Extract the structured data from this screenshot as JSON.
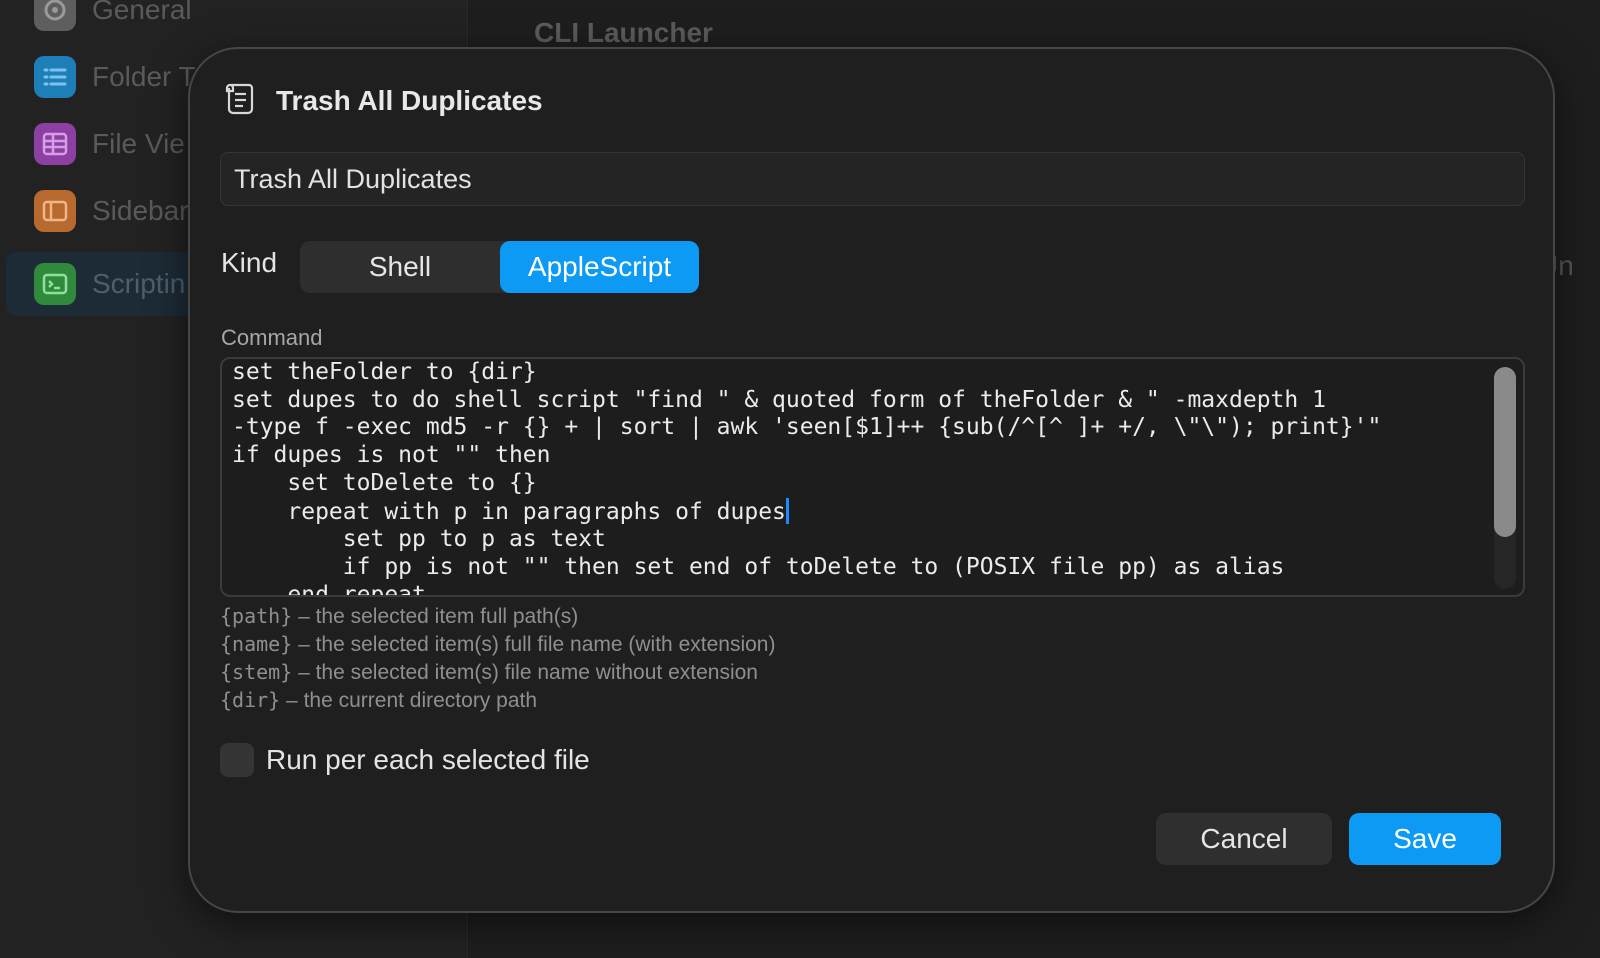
{
  "background": {
    "sidebar": {
      "items": [
        {
          "label": "General",
          "icon": "gear-icon",
          "color": "#5e5e5e"
        },
        {
          "label": "Folder T",
          "icon": "list-icon",
          "color": "#1e7fb8"
        },
        {
          "label": "File Vie",
          "icon": "table-icon",
          "color": "#8e3fa3"
        },
        {
          "label": "Sidebar",
          "icon": "sidebar-icon",
          "color": "#b8692e"
        },
        {
          "label": "Scriptin",
          "icon": "terminal-icon",
          "color": "#2f8a3c"
        }
      ],
      "selected_index": 4
    },
    "main_title": "CLI Launcher",
    "right_text": "Un"
  },
  "dialog": {
    "title": "Trash All Duplicates",
    "title_icon": "scroll-icon",
    "name_value": "Trash All Duplicates",
    "kind_label": "Kind",
    "kind_options": [
      "Shell",
      "AppleScript"
    ],
    "kind_selected": "AppleScript",
    "command_label": "Command",
    "command_lines": [
      "set theFolder to {dir}",
      "set dupes to do shell script \"find \" & quoted form of theFolder & \" -maxdepth 1",
      "-type f -exec md5 -r {} + | sort | awk 'seen[$1]++ {sub(/^[^ ]+ +/, \\\"\\\"); print}'\"",
      "if dupes is not \"\" then",
      "    set toDelete to {}",
      "    repeat with p in paragraphs of dupes",
      "        set pp to p as text",
      "        if pp is not \"\" then set end of toDelete to (POSIX file pp) as alias",
      "    end repeat"
    ],
    "hints": [
      {
        "token": "{path}",
        "text": " – the selected item full path(s)"
      },
      {
        "token": "{name}",
        "text": " – the selected item(s) full file name (with extension)"
      },
      {
        "token": "{stem}",
        "text": " – the selected item(s) file name without extension"
      },
      {
        "token": "{dir}",
        "text": " – the current directory path"
      }
    ],
    "run_per_file_label": "Run per each selected file",
    "run_per_file_checked": false,
    "cancel_label": "Cancel",
    "save_label": "Save",
    "accent_color": "#0c9af5"
  }
}
